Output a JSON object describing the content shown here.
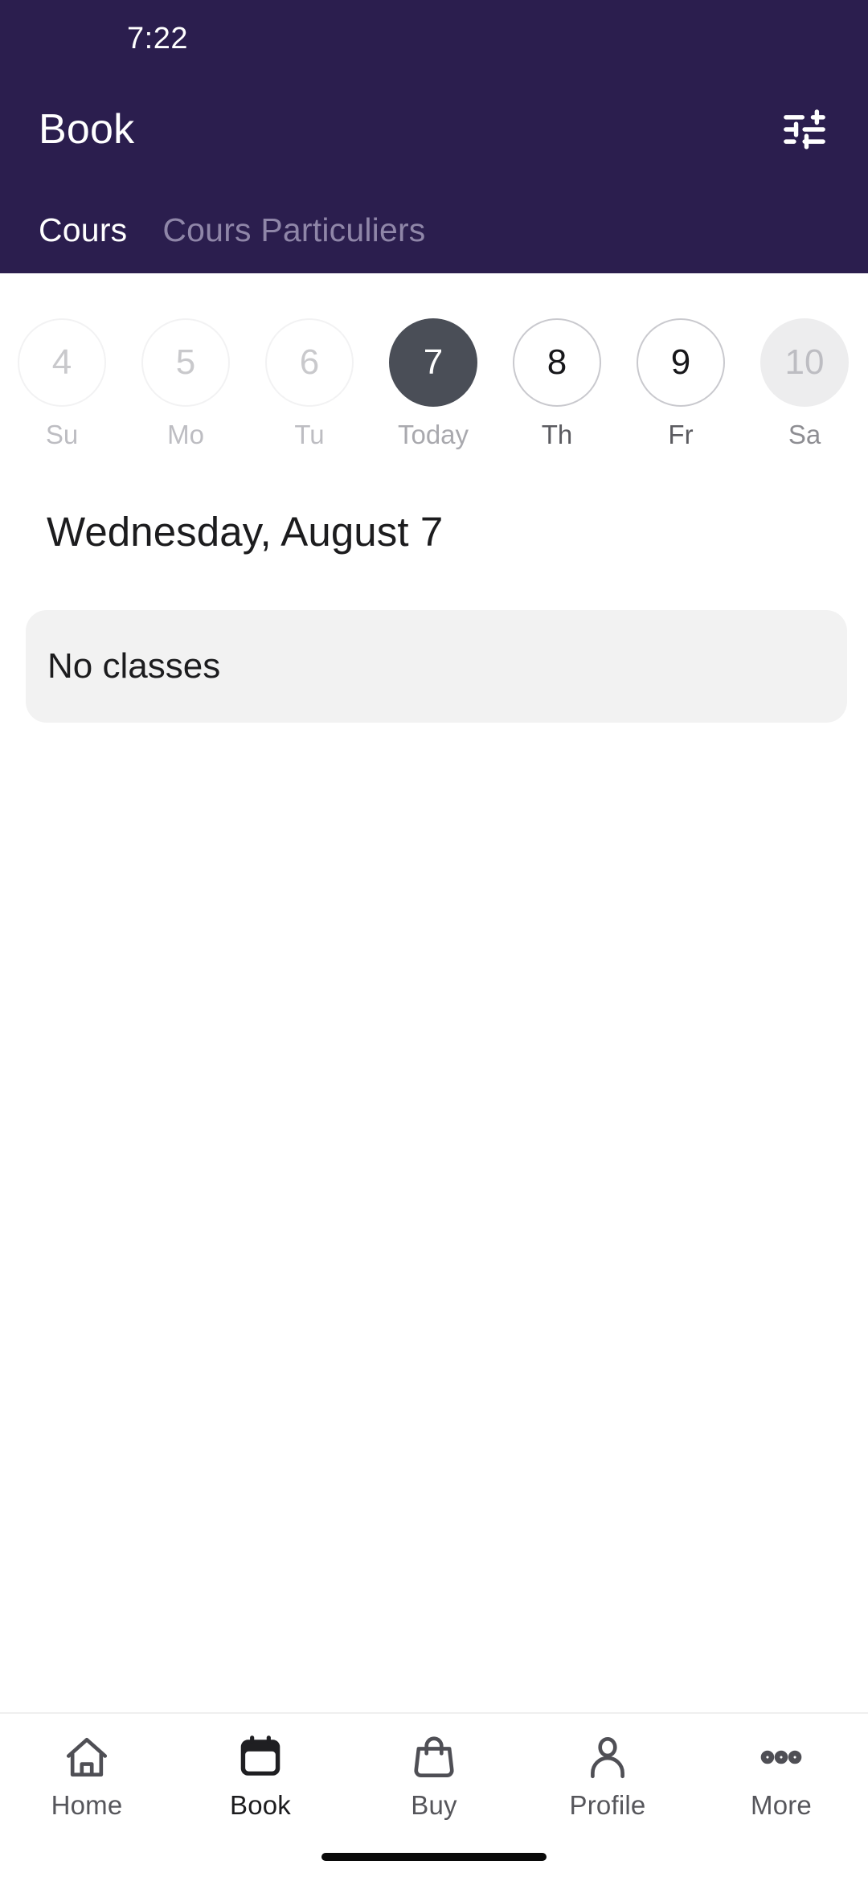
{
  "status_bar": {
    "time": "7:22"
  },
  "header": {
    "title": "Book",
    "filter_icon": "tune-icon",
    "accent_color": "#2B1E4E",
    "tabs": [
      {
        "label": "Cours",
        "active": true
      },
      {
        "label": "Cours Particuliers",
        "active": false
      }
    ]
  },
  "date_strip": {
    "days": [
      {
        "number": "4",
        "weekday": "Su",
        "state": "past"
      },
      {
        "number": "5",
        "weekday": "Mo",
        "state": "past"
      },
      {
        "number": "6",
        "weekday": "Tu",
        "state": "past"
      },
      {
        "number": "7",
        "weekday": "Today",
        "state": "today"
      },
      {
        "number": "8",
        "weekday": "Th",
        "state": "avail"
      },
      {
        "number": "9",
        "weekday": "Fr",
        "state": "avail"
      },
      {
        "number": "10",
        "weekday": "Sa",
        "state": "faded"
      }
    ],
    "selected_color": "#4A4E57"
  },
  "main": {
    "date_heading": "Wednesday, August 7",
    "empty_message": "No classes"
  },
  "bottom_nav": {
    "items": [
      {
        "label": "Home",
        "icon": "home-icon",
        "active": false
      },
      {
        "label": "Book",
        "icon": "calendar-icon",
        "active": true
      },
      {
        "label": "Buy",
        "icon": "bag-icon",
        "active": false
      },
      {
        "label": "Profile",
        "icon": "person-icon",
        "active": false
      },
      {
        "label": "More",
        "icon": "ellipsis-icon",
        "active": false
      }
    ]
  }
}
